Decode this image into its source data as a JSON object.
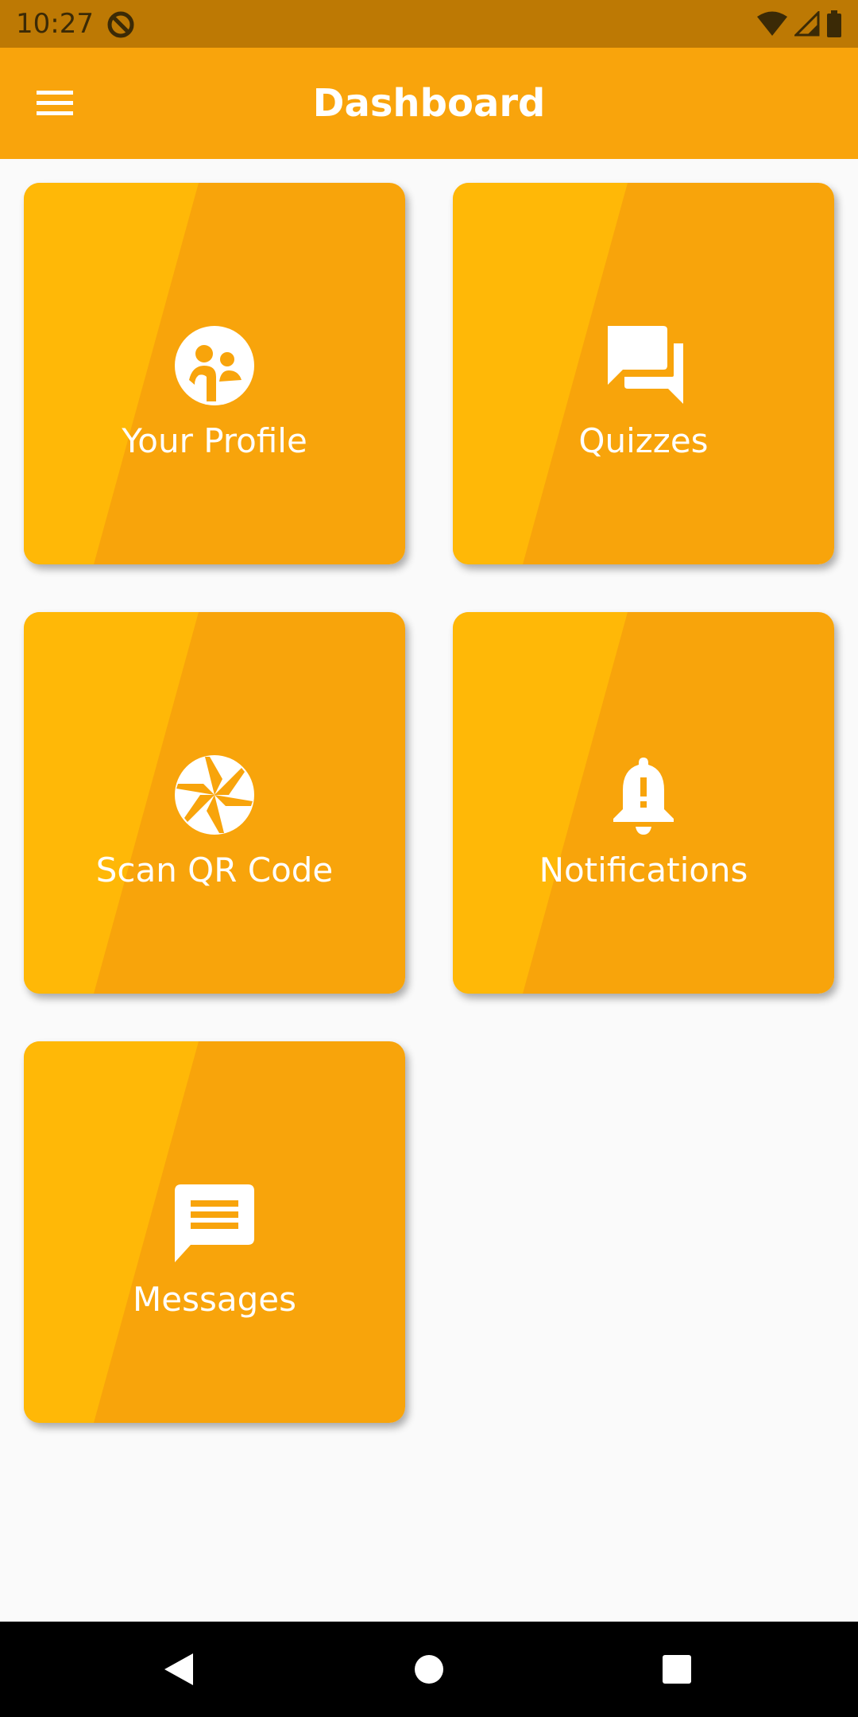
{
  "status_bar": {
    "time": "10:27",
    "icons": [
      "do-not-disturb-icon",
      "wifi-icon",
      "signal-icon",
      "battery-icon"
    ]
  },
  "app_bar": {
    "title": "Dashboard",
    "menu_icon": "menu-icon"
  },
  "cards": [
    {
      "label": "Your Profile",
      "icon": "profile-group-icon"
    },
    {
      "label": "Quizzes",
      "icon": "forum-icon"
    },
    {
      "label": "Scan QR Code",
      "icon": "camera-aperture-icon"
    },
    {
      "label": "Notifications",
      "icon": "bell-alert-icon"
    },
    {
      "label": "Messages",
      "icon": "message-icon"
    }
  ],
  "nav_bar": {
    "buttons": [
      "back-icon",
      "home-icon",
      "recents-icon"
    ]
  },
  "colors": {
    "status_bar": "#bd7904",
    "app_bar": "#f9a40c",
    "card_light": "#ffb807",
    "card_dark": "#f8a40b",
    "background": "#fafafa"
  }
}
